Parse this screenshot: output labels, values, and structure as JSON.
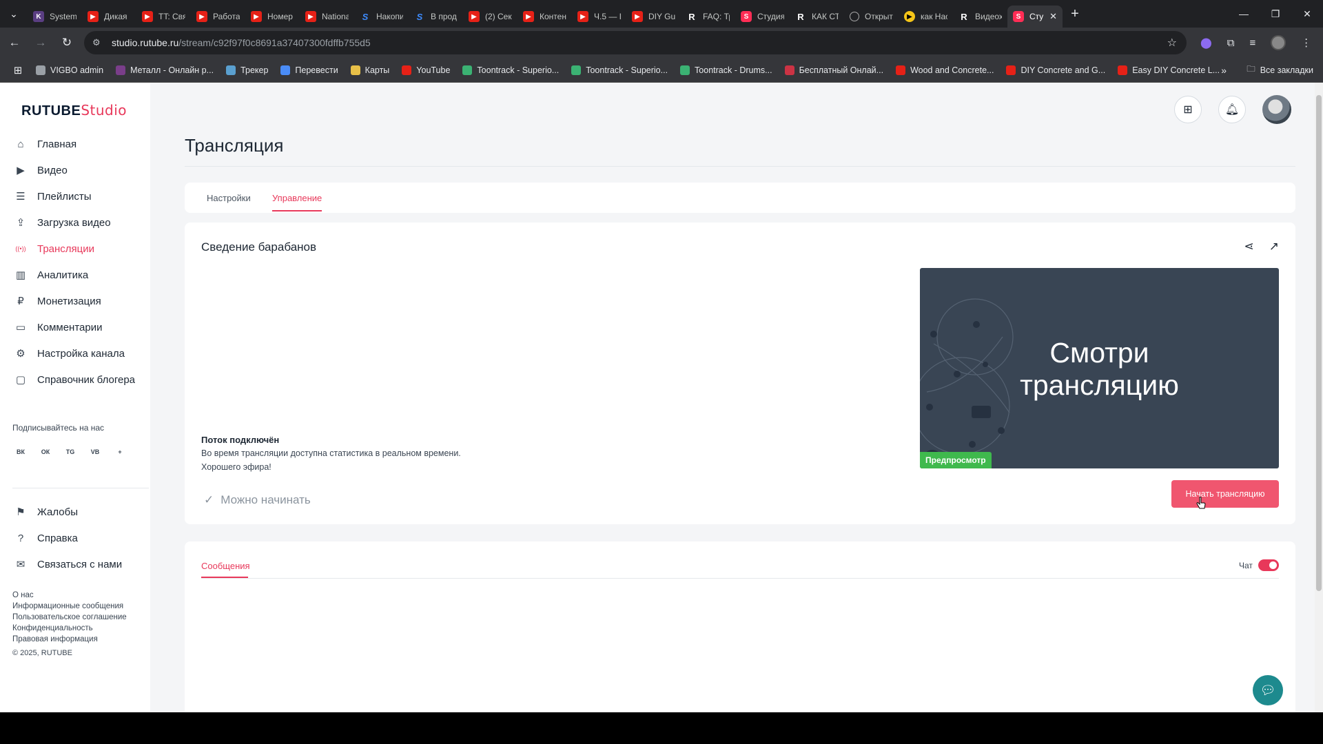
{
  "browser": {
    "tabs": [
      {
        "label": "System",
        "icon": "k-icon"
      },
      {
        "label": "Дикая",
        "icon": "youtube-icon"
      },
      {
        "label": "TT: Свя",
        "icon": "youtube-icon"
      },
      {
        "label": "Работа",
        "icon": "youtube-icon"
      },
      {
        "label": "Номер",
        "icon": "youtube-icon"
      },
      {
        "label": "Nationa",
        "icon": "youtube-icon"
      },
      {
        "label": "Накопи",
        "icon": "s-icon"
      },
      {
        "label": "В прод",
        "icon": "s-icon"
      },
      {
        "label": "(2) Сек",
        "icon": "youtube-icon"
      },
      {
        "label": "Контен",
        "icon": "youtube-icon"
      },
      {
        "label": "Ч.5 — I",
        "icon": "youtube-icon"
      },
      {
        "label": "DIY Gu",
        "icon": "youtube-icon"
      },
      {
        "label": "FAQ: Тр",
        "icon": "rutube-icon"
      },
      {
        "label": "Студия",
        "icon": "studio-icon"
      },
      {
        "label": "КАК СТ",
        "icon": "rutube-icon"
      },
      {
        "label": "Открыт",
        "icon": "circle-icon"
      },
      {
        "label": "как Нас",
        "icon": "yellow-icon"
      },
      {
        "label": "Видеох",
        "icon": "rutube-icon"
      },
      {
        "label": "Сту",
        "icon": "studio-icon",
        "active": true
      }
    ],
    "url_host": "studio.rutube.ru",
    "url_path": "/stream/c92f97f0c8691a37407300fdffb755d5",
    "bookmarks": [
      {
        "label": "VIGBO admin"
      },
      {
        "label": "Металл - Онлайн р..."
      },
      {
        "label": "Трекер"
      },
      {
        "label": "Перевести"
      },
      {
        "label": "Карты"
      },
      {
        "label": "YouTube"
      },
      {
        "label": "Toontrack - Superio..."
      },
      {
        "label": "Toontrack - Superio..."
      },
      {
        "label": "Toontrack - Drums..."
      },
      {
        "label": "Бесплатный Онлай..."
      },
      {
        "label": "Wood and Concrete..."
      },
      {
        "label": "DIY Concrete and G..."
      },
      {
        "label": "Easy DIY Concrete L..."
      }
    ],
    "all_bookmarks": "Все закладки"
  },
  "logo": {
    "brand": "RUTUBE",
    "product": "Studio"
  },
  "sidebar": {
    "items": [
      {
        "label": "Главная",
        "icon": "home-icon"
      },
      {
        "label": "Видео",
        "icon": "video-icon"
      },
      {
        "label": "Плейлисты",
        "icon": "playlist-icon"
      },
      {
        "label": "Загрузка видео",
        "icon": "upload-icon"
      },
      {
        "label": "Трансляции",
        "icon": "broadcast-icon",
        "active": true
      },
      {
        "label": "Аналитика",
        "icon": "analytics-icon"
      },
      {
        "label": "Монетизация",
        "icon": "ruble-icon"
      },
      {
        "label": "Комментарии",
        "icon": "comment-icon"
      },
      {
        "label": "Настройка канала",
        "icon": "gear-icon"
      },
      {
        "label": "Справочник блогера",
        "icon": "help-book-icon"
      }
    ],
    "follow_label": "Подписывайтесь на нас",
    "social": [
      "ВК",
      "ОК",
      "TG",
      "VB",
      "+"
    ],
    "secondary": [
      {
        "label": "Жалобы",
        "icon": "flag-icon"
      },
      {
        "label": "Справка",
        "icon": "question-icon"
      },
      {
        "label": "Связаться с нами",
        "icon": "mail-icon"
      }
    ],
    "footer_links": [
      "О нас",
      "Информационные сообщения",
      "Пользовательское соглашение",
      "Конфиденциальность",
      "Правовая информация"
    ],
    "copyright": "© 2025, RUTUBE"
  },
  "page": {
    "title": "Трансляция",
    "tabs": {
      "settings": "Настройки",
      "manage": "Управление"
    },
    "stream": {
      "name": "Сведение барабанов",
      "status_title": "Поток подключён",
      "status_line1": "Во время трансляции доступна статистика в реальном времени.",
      "status_line2": "Хорошего эфира!",
      "preview_line1": "Смотри",
      "preview_line2": "трансляцию",
      "preview_badge": "Предпросмотр",
      "ready": "Можно начинать",
      "start_button": "Начать трансляцию"
    },
    "chat": {
      "tab": "Сообщения",
      "toggle_label": "Чат",
      "toggle_on": true
    }
  },
  "colors": {
    "accent": "#e8385a",
    "button": "#f0566f",
    "preview_bg": "#394554",
    "badge": "#3fb94d"
  }
}
